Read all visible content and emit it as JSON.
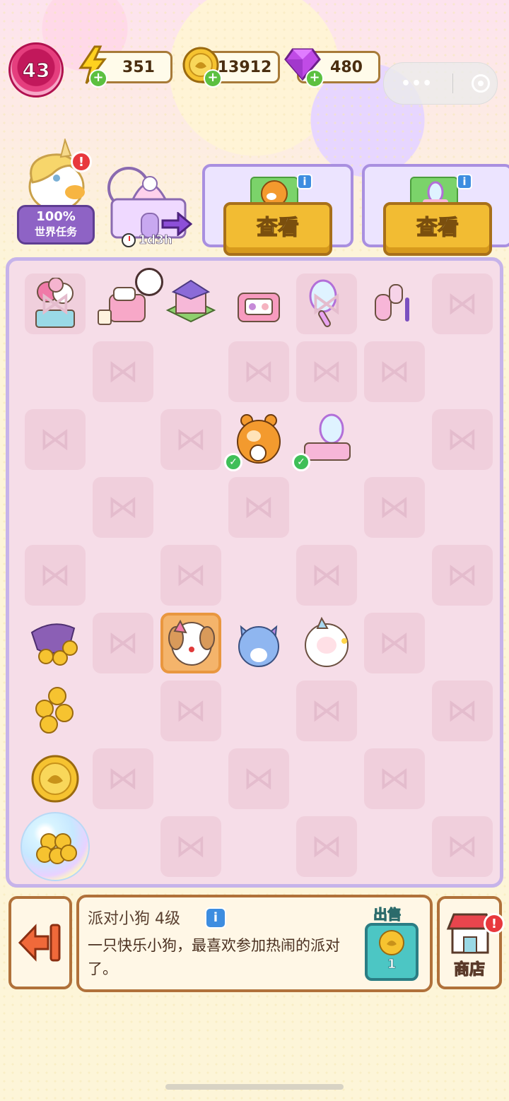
{
  "hud": {
    "level": "43",
    "energy": "351",
    "coins": "13912",
    "gems": "480"
  },
  "world_task": {
    "percent": "100%",
    "label": "世界任务"
  },
  "event": {
    "timer": "1d3h"
  },
  "orders": [
    {
      "button": "查看"
    },
    {
      "button": "查看"
    }
  ],
  "info_panel": {
    "title": "派对小狗 4级",
    "description": "一只快乐小狗，最喜欢参加热闹的派对了。",
    "sell_label": "出售",
    "sell_price": "1"
  },
  "shop": {
    "label": "商店"
  },
  "colors": {
    "accent": "#f2bc33",
    "board_border": "#c6b3ea",
    "panel_border": "#b0713a"
  },
  "board": {
    "rows": [
      [
        "balloons",
        "bed",
        "house",
        "makeup-palette",
        "hand-mirror",
        "hair-roller",
        "slot"
      ],
      [
        "empty",
        "slot",
        "empty",
        "slot",
        "slot",
        "slot",
        "empty"
      ],
      [
        "slot",
        "empty",
        "slot",
        "hamster",
        "vanity",
        "empty",
        "slot"
      ],
      [
        "empty",
        "slot",
        "empty",
        "slot",
        "empty",
        "slot",
        "empty"
      ],
      [
        "slot",
        "empty",
        "slot",
        "empty",
        "slot",
        "empty",
        "slot"
      ],
      [
        "coin-bag",
        "slot",
        "party-dog",
        "blue-cat",
        "sheep",
        "slot",
        "empty"
      ],
      [
        "coin-stack",
        "empty",
        "slot",
        "empty",
        "slot",
        "empty",
        "slot"
      ],
      [
        "coin",
        "slot",
        "empty",
        "slot",
        "empty",
        "slot",
        "empty"
      ],
      [
        "coin-bubble",
        "empty",
        "slot",
        "empty",
        "slot",
        "empty",
        "slot"
      ]
    ]
  }
}
